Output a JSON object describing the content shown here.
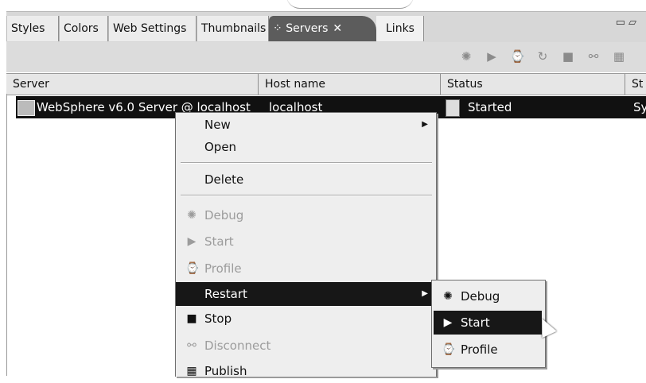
{
  "tabs": [
    {
      "label": "Styles"
    },
    {
      "label": "Colors"
    },
    {
      "label": "Web Settings"
    },
    {
      "label": "Thumbnails"
    },
    {
      "label": "Servers",
      "close": "✕"
    },
    {
      "label": "Links"
    }
  ],
  "window_controls": "▭ ▱",
  "toolbar_icons": [
    "debug-icon",
    "start-icon",
    "profile-icon",
    "restart-icon",
    "stop-icon",
    "disconnect-icon",
    "publish-icon"
  ],
  "table": {
    "columns": [
      "Server",
      "Host name",
      "Status",
      "St"
    ],
    "rows": [
      {
        "server": "WebSphere v6.0 Server @ localhost",
        "host": "localhost",
        "status": "Started",
        "state": "Sy"
      }
    ]
  },
  "context_menu": {
    "items": [
      {
        "label": "New",
        "submenu": true
      },
      {
        "label": "Open"
      },
      {
        "label": "Delete"
      },
      {
        "label": "Debug",
        "disabled": true
      },
      {
        "label": "Start",
        "disabled": true
      },
      {
        "label": "Profile",
        "disabled": true
      },
      {
        "label": "Restart",
        "submenu": true,
        "selected": true
      },
      {
        "label": "Stop"
      },
      {
        "label": "Disconnect",
        "disabled": true
      },
      {
        "label": "Publish"
      }
    ]
  },
  "restart_submenu": {
    "items": [
      {
        "label": "Debug"
      },
      {
        "label": "Start",
        "selected": true
      },
      {
        "label": "Profile"
      }
    ]
  },
  "colors": {
    "selection": "#171717",
    "menu_bg": "#eeeeee",
    "tab_active": "#5c5c5c"
  }
}
